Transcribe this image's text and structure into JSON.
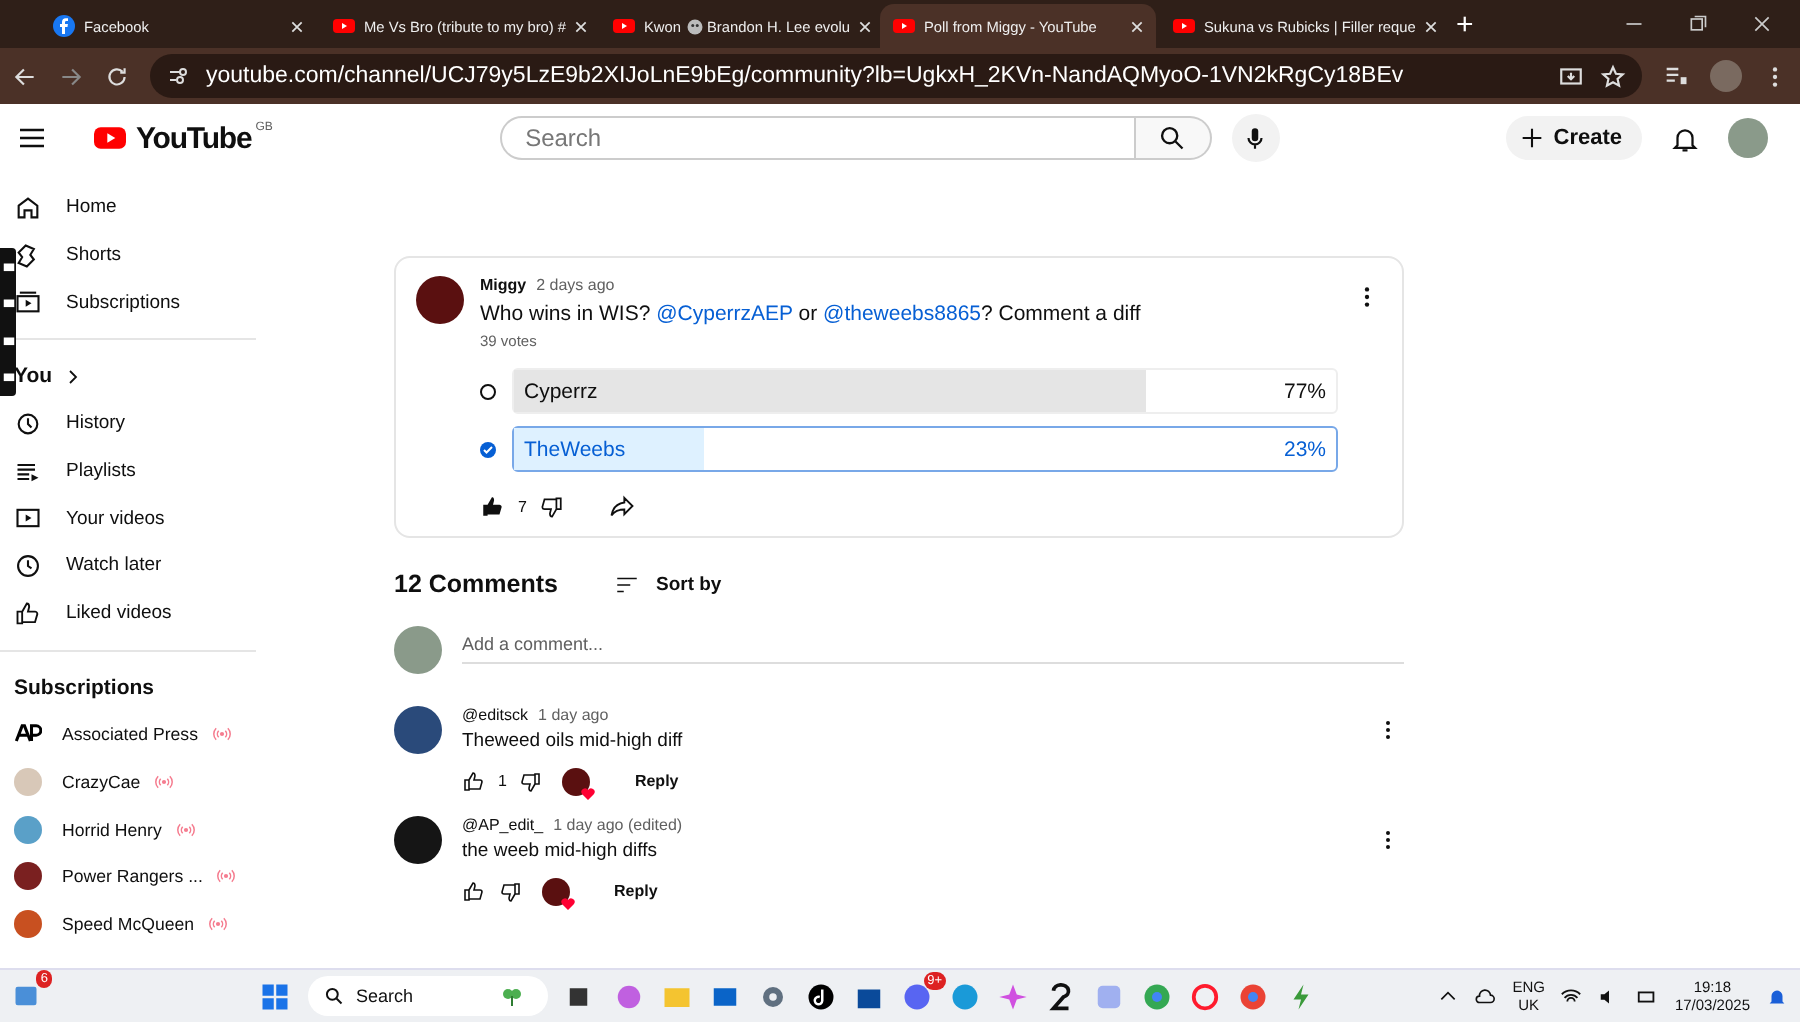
{
  "browser": {
    "tabs": [
      {
        "title": "Facebook",
        "selected": false
      },
      {
        "title": "Me Vs Bro (tribute to my bro) #",
        "selected": false
      },
      {
        "title": "Kwon",
        "title_after": "Brandon H. Lee evolu",
        "selected": false
      },
      {
        "title": "Poll from Miggy - YouTube",
        "selected": true
      },
      {
        "title": "Sukuna vs Rubicks | Filler reque",
        "selected": false
      }
    ],
    "new_tab": "+",
    "address": "youtube.com/channel/UCJ79y5LzE9b2XIJoLnE9bEg/community?lb=UgkxH_2KVn-NandAQMyoO-1VN2kRgCy18BEv"
  },
  "header": {
    "logo": "YouTube",
    "region": "GB",
    "search": {
      "placeholder": "Search"
    },
    "create": "Create"
  },
  "sidebar": {
    "main": [
      "Home",
      "Shorts",
      "Subscriptions"
    ],
    "you": {
      "title": "You",
      "items": [
        "History",
        "Playlists",
        "Your videos",
        "Watch later",
        "Liked videos"
      ]
    },
    "subscriptions": {
      "title": "Subscriptions",
      "items": [
        {
          "name": "Associated Press",
          "live": true
        },
        {
          "name": "CrazyCae",
          "live": true
        },
        {
          "name": "Horrid Henry",
          "live": true
        },
        {
          "name": "Power Rangers ...",
          "live": true
        },
        {
          "name": "Speed McQueen",
          "live": true
        }
      ]
    }
  },
  "post": {
    "author": "Miggy",
    "time": "2 days ago",
    "text": [
      {
        "kind": "text",
        "text": "Who wins in WIS? "
      },
      {
        "kind": "link",
        "text": "@CyperrzAEP"
      },
      {
        "kind": "text",
        "text": " or "
      },
      {
        "kind": "link",
        "text": "@theweebs8865"
      },
      {
        "kind": "text",
        "text": "? Comment a diff"
      }
    ],
    "votes": "39 votes",
    "options": [
      {
        "label": "Cyperrz",
        "percent": "77%",
        "level": 0.77,
        "selected": false
      },
      {
        "label": "TheWeebs",
        "percent": "23%",
        "level": 0.23,
        "selected": true
      }
    ],
    "likes": "7",
    "liked": true
  },
  "comments": {
    "count": "12 Comments",
    "sort": "Sort by",
    "placeholder": "Add a comment...",
    "items": [
      {
        "author": "@editsck",
        "time": "1 day ago",
        "text": "Theweed oils mid-high diff",
        "likes": "1",
        "hearted": true,
        "reply": "Reply"
      },
      {
        "author": "@AP_edit_",
        "time": "1 day ago (edited)",
        "text": "the weeb mid-high diffs",
        "hearted": true,
        "reply": "Reply"
      }
    ]
  },
  "taskbar": {
    "widget_badge": "6",
    "search": "Search",
    "discord_badge": "9+",
    "lang": "ENG",
    "region": "UK",
    "time": "19:18",
    "date": "17/03/2025"
  }
}
